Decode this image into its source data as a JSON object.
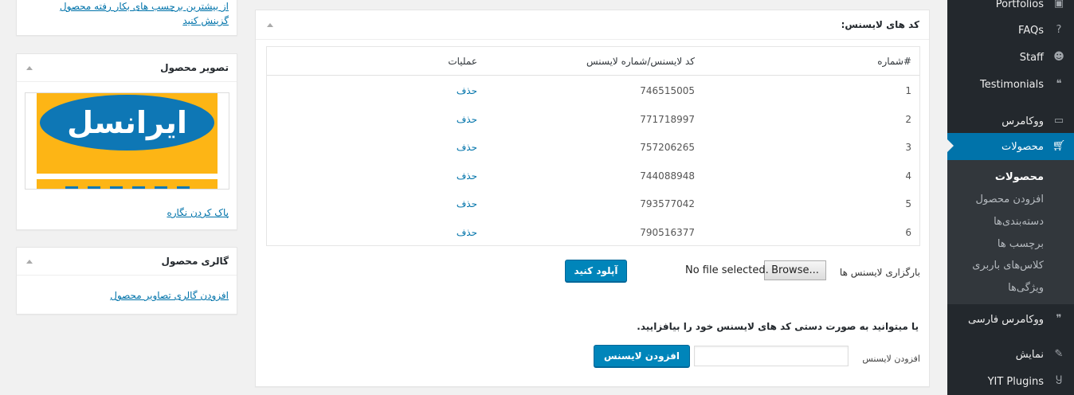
{
  "left": {
    "top_box": {
      "line1": "از بیشترین برچسب های بکار رفته محصول",
      "line2": "گزینش کنید"
    },
    "image_box": {
      "title": "تصویر محصول",
      "logo_text": "ایرانسل",
      "remove_link": "پاک کردن نگاره"
    },
    "gallery_box": {
      "title": "گالری محصول",
      "add_link": "افزودن گالری تصاویر محصول"
    }
  },
  "main": {
    "title": "کد های لایسنس:",
    "table": {
      "headers": {
        "num": "#شماره",
        "code": "کد لایسنس/شماره لایسنس",
        "ops": "عملیات"
      },
      "rows": [
        {
          "num": "1",
          "code": "746515005",
          "op": "حذف"
        },
        {
          "num": "2",
          "code": "771718997",
          "op": "حذف"
        },
        {
          "num": "3",
          "code": "757206265",
          "op": "حذف"
        },
        {
          "num": "4",
          "code": "744088948",
          "op": "حذف"
        },
        {
          "num": "5",
          "code": "793577042",
          "op": "حذف"
        },
        {
          "num": "6",
          "code": "790516377",
          "op": "حذف"
        }
      ]
    },
    "upload": {
      "label": "بارگزاری لایسنس ها",
      "browse": "Browse...",
      "no_file": "No file selected.",
      "button": "آپلود کنید"
    },
    "manual_note": "یا میتوانید به صورت دستی کد های لایسنس خود را بیافزایید.",
    "add": {
      "label": "افزودن لایسنس",
      "input_value": "",
      "button": "افزودن لایسنس"
    }
  },
  "menu": {
    "items": [
      {
        "label": "Portfolios",
        "icon": "portfolio-icon"
      },
      {
        "label": "FAQs",
        "icon": "help-icon"
      },
      {
        "label": "Staff",
        "icon": "groups-icon"
      },
      {
        "label": "Testimonials",
        "icon": "testimonial-icon"
      },
      {
        "label": "ووکامرس",
        "icon": "woo-icon"
      },
      {
        "label": "محصولات",
        "icon": "cart-icon"
      },
      {
        "label": "ووکامرس فارسی",
        "icon": "quote-icon"
      },
      {
        "label": "نمایش",
        "icon": "appearance-icon"
      },
      {
        "label": "YIT Plugins",
        "icon": "yit-icon"
      }
    ],
    "submenu": [
      "محصولات",
      "افزودن محصول",
      "دسته‌بندی‌ها",
      "برچسب ها",
      "کلاس‌های باربری",
      "ویژگی‌ها"
    ],
    "colors": {
      "background": "#23282d",
      "current": "#0073aa",
      "submenu_bg": "#32373c"
    }
  }
}
